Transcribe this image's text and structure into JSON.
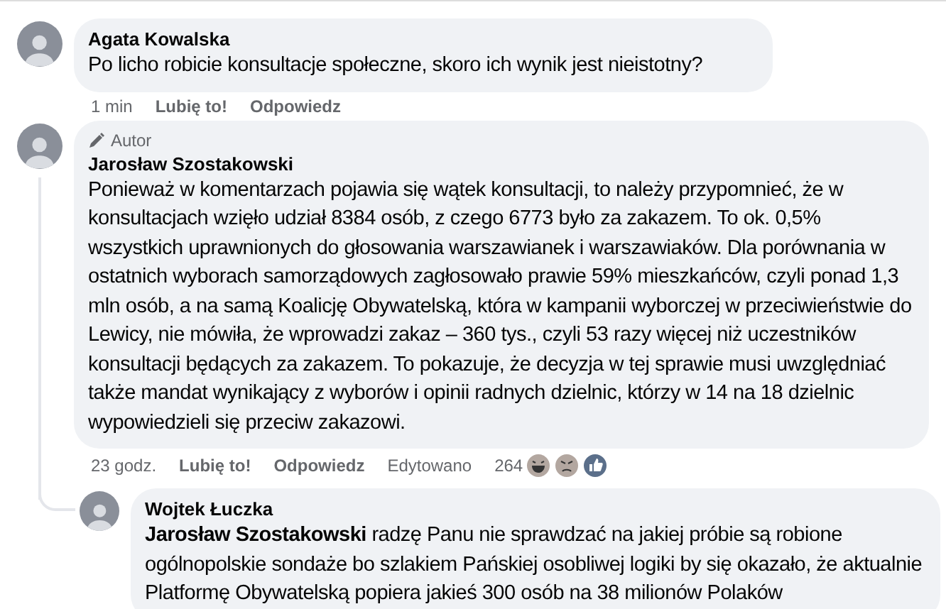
{
  "comments": [
    {
      "author": "Agata Kowalska",
      "text": "Po licho robicie konsultacje społeczne, skoro ich wynik jest nieistotny?",
      "time": "1 min",
      "like": "Lubię to!",
      "reply": "Odpowiedz"
    },
    {
      "author": "Jarosław Szostakowski",
      "badge": "Autor",
      "text": "Ponieważ w komentarzach pojawia się wątek konsultacji, to należy przypomnieć, że w konsultacjach wzięło udział 8384 osób, z czego 6773 było za zakazem. To ok. 0,5% wszystkich uprawnionych do głosowania warszawianek i warszawiaków. Dla porównania w ostatnich wyborach samorządowych zagłosowało prawie 59% mieszkańców, czyli ponad 1,3 mln osób, a na samą Koalicję Obywatelską, która w kampanii wyborczej w przeciwieństwie do Lewicy, nie mówiła, że wprowadzi zakaz – 360 tys., czyli 53 razy więcej niż uczestników konsultacji będących za zakazem. To pokazuje, że decyzja w tej sprawie musi uwzględniać także mandat wynikający z wyborów i opinii radnych dzielnic, którzy w 14 na 18 dzielnic wypowiedzieli się przeciw zakazowi.",
      "time": "23 godz.",
      "like": "Lubię to!",
      "reply": "Odpowiedz",
      "edited": "Edytowano",
      "reactions_count": "264",
      "replies": [
        {
          "author": "Wojtek Łuczka",
          "text": "**Jarosław Szostakowski** radzę Panu nie sprawdzać na jakiej próbie są robione ogólnopolskie sondaże bo szlakiem Pańskiej osobliwej logiki by się okazało, że aktualnie Platformę Obywatelską popiera jakieś 300 osób na 38 milionów Polaków"
        }
      ]
    }
  ]
}
